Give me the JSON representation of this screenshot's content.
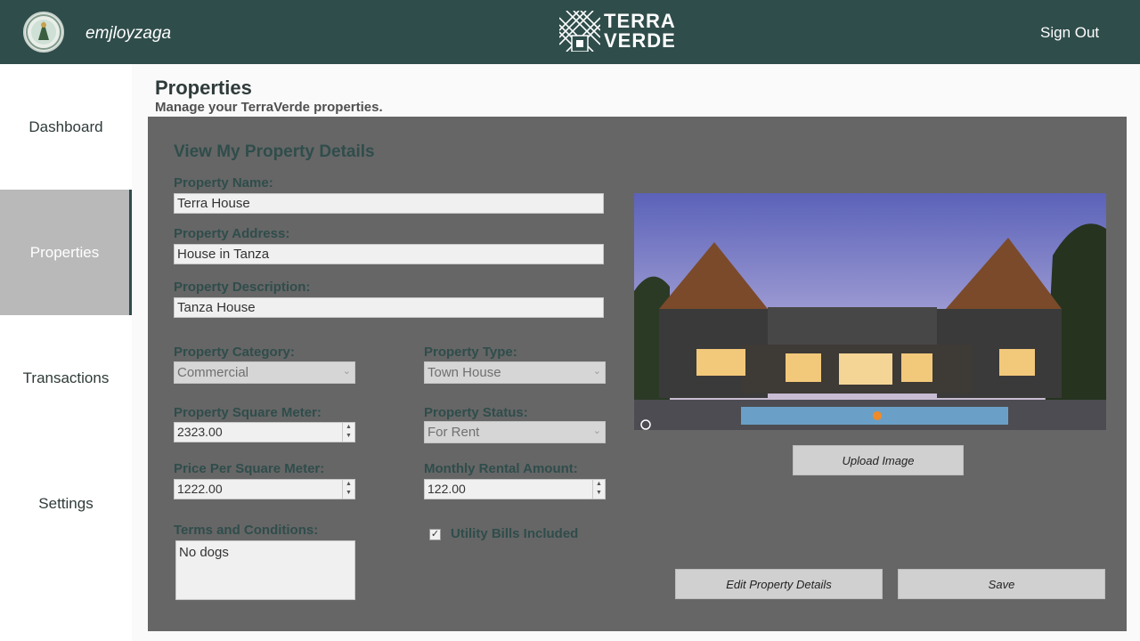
{
  "header": {
    "username": "emjloyzaga",
    "brand_line1": "TERRA",
    "brand_line2": "VERDE",
    "signout_label": "Sign Out"
  },
  "sidebar": {
    "items": [
      {
        "label": "Dashboard",
        "active": false
      },
      {
        "label": "Properties",
        "active": true
      },
      {
        "label": "Transactions",
        "active": false
      },
      {
        "label": "Settings",
        "active": false
      }
    ]
  },
  "page": {
    "title": "Properties",
    "subtitle": "Manage your TerraVerde properties."
  },
  "form": {
    "heading": "View My Property Details",
    "name_label": "Property Name:",
    "name_value": "Terra House",
    "address_label": "Property Address:",
    "address_value": "House in Tanza",
    "description_label": "Property Description:",
    "description_value": "Tanza House",
    "category_label": "Property Category:",
    "category_value": "Commercial",
    "type_label": "Property Type:",
    "type_value": "Town House",
    "sqm_label": "Property Square Meter:",
    "sqm_value": "2323.00",
    "status_label": "Property Status:",
    "status_value": "For Rent",
    "price_label": "Price Per Square Meter:",
    "price_value": "1222.00",
    "rental_label": "Monthly Rental Amount:",
    "rental_value": "122.00",
    "terms_label": "Terms and Conditions:",
    "terms_value": "No dogs",
    "utility_label": "Utility Bills Included",
    "utility_checked": true
  },
  "buttons": {
    "upload": "Upload Image",
    "edit": "Edit Property Details",
    "save": "Save"
  },
  "colors": {
    "header_bg": "#2f4d4b",
    "panel_bg": "#666666",
    "label_color": "#2f4d4b",
    "sidebar_active": "#b9b9b9"
  },
  "icons": {
    "dropdown": "chevron-down-icon",
    "checkbox": "check-icon",
    "camera": "camera-icon"
  }
}
